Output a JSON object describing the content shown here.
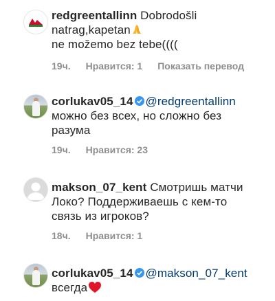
{
  "comments": [
    {
      "username": "redgreentallinn",
      "avatar_icon": "club-logo-icon",
      "text_line1": "Dobrodošli",
      "text_line2": "natrag,kapetan",
      "text_emoji": "folded-hands-icon",
      "text_line3": "ne možemo bez tebe((((",
      "time": "19ч.",
      "likes": "Нравится: 1",
      "translate": "Показать перевод"
    },
    {
      "username": "corlukav05_14",
      "verified": true,
      "avatar_icon": "user-photo-avatar",
      "mention": "@redgreentallinn",
      "text_line1": "можно без всех, но сложно без",
      "text_line2": "разума",
      "time": "19ч.",
      "likes": "Нравится: 23"
    },
    {
      "username": "makson_07_kent",
      "avatar_icon": "default-avatar-icon",
      "text_inline": "Смотришь матчи",
      "text_line2": "Локо?  Поддерживаешь с кем-то",
      "text_line3": "связь из игроков?",
      "time": "18ч.",
      "likes": "Нравится: 1"
    },
    {
      "username": "corlukav05_14",
      "verified": true,
      "avatar_icon": "user-photo-avatar",
      "mention": "@makson_07_kent",
      "text_line2": "всегда",
      "text_emoji": "red-heart-icon"
    }
  ],
  "colors": {
    "verified": "#3897f0",
    "meta": "#8e8e8e",
    "mention": "#00376b",
    "heart": "#e0162b"
  }
}
